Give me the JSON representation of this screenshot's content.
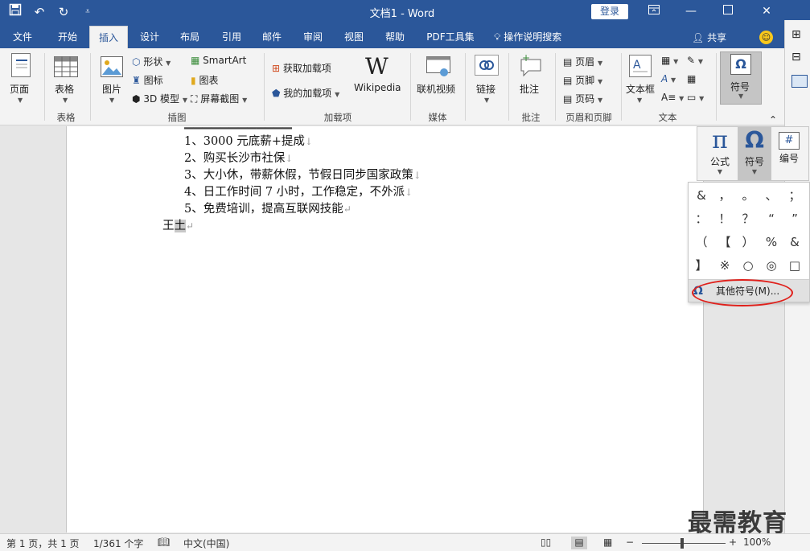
{
  "window": {
    "title": "文档1  -  Word",
    "login_label": "登录",
    "qat": {
      "save_icon": "save-icon",
      "undo_icon": "undo-icon",
      "redo_icon": "redo-icon",
      "customize_icon": "qat-customize-icon"
    }
  },
  "tabs": [
    {
      "label": "文件"
    },
    {
      "label": "开始"
    },
    {
      "label": "插入",
      "active": true
    },
    {
      "label": "设计"
    },
    {
      "label": "布局"
    },
    {
      "label": "引用"
    },
    {
      "label": "邮件"
    },
    {
      "label": "审阅"
    },
    {
      "label": "视图"
    },
    {
      "label": "帮助"
    },
    {
      "label": "PDF工具集"
    },
    {
      "label": "操作说明搜索"
    }
  ],
  "share_label": "共享",
  "ribbon": {
    "pages": {
      "button": "页面",
      "group": ""
    },
    "tables": {
      "button": "表格",
      "group": "表格"
    },
    "illustrations": {
      "group": "插图",
      "picture": "图片",
      "shapes": "形状",
      "icons": "图标",
      "model3d": "3D 模型",
      "smartart": "SmartArt",
      "chart": "图表",
      "screenshot": "屏幕截图"
    },
    "addins": {
      "group": "加载项",
      "get": "获取加载项",
      "my": "我的加载项",
      "wikipedia": "Wikipedia"
    },
    "media": {
      "group": "媒体",
      "online_video": "联机视频"
    },
    "links": {
      "button": "链接"
    },
    "comments": {
      "group": "批注",
      "button": "批注"
    },
    "header_footer": {
      "group": "页眉和页脚",
      "header": "页眉",
      "footer": "页脚",
      "page_number": "页码"
    },
    "text": {
      "group": "文本",
      "textbox": "文本框"
    },
    "symbols": {
      "button": "符号"
    }
  },
  "document": {
    "lines": [
      "1、3000 元底薪+提成",
      "2、购买长沙市社保",
      "3、大小休，带薪休假，节假日同步国家政策",
      "4、日工作时间 7 小时，工作稳定，不外派",
      "5、免费培训，提高互联网技能"
    ],
    "name_line": "王",
    "selected_char": "土",
    "para_mark": "↵",
    "line_break_mark": "↓"
  },
  "symbol_pane": {
    "formula": "公式",
    "symbol": "符号",
    "numbering": "编号"
  },
  "symbol_grid": [
    "&",
    "，",
    "。",
    "、",
    "；",
    "：",
    "！",
    "？",
    "“",
    "”",
    "（",
    "【",
    "）",
    "%",
    "&",
    "】",
    "※",
    "○",
    "◎",
    "□"
  ],
  "more_symbols_label": "其他符号(M)...",
  "status": {
    "page": "第 1 页，共 1 页",
    "words": "1/361 个字",
    "language": "中文(中国)",
    "zoom": "100%",
    "zoom_level": 100
  },
  "watermark": "最需教育",
  "colors": {
    "brand": "#2b579a",
    "highlight": "#e0201b"
  }
}
